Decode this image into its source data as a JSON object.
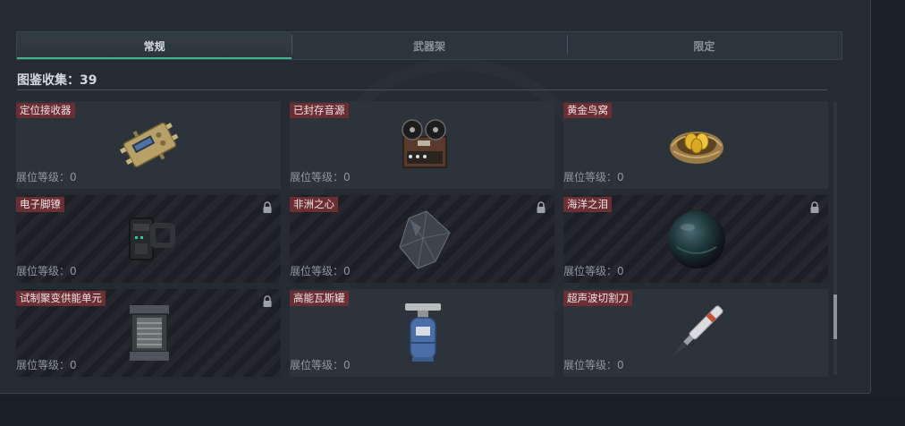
{
  "tabs": [
    {
      "label": "常规",
      "active": true
    },
    {
      "label": "武器架",
      "active": false
    },
    {
      "label": "限定",
      "active": false
    }
  ],
  "collection": {
    "label": "图鉴收集：",
    "count": "39"
  },
  "items": [
    {
      "name": "定位接收器",
      "level": "展位等级：0",
      "locked": false,
      "icon": "gps-receiver-icon"
    },
    {
      "name": "已封存音源",
      "level": "展位等级：0",
      "locked": false,
      "icon": "reel-tape-recorder-icon"
    },
    {
      "name": "黄金鸟窝",
      "level": "展位等级：0",
      "locked": false,
      "icon": "golden-nest-icon"
    },
    {
      "name": "电子脚镣",
      "level": "展位等级：0",
      "locked": true,
      "icon": "ankle-monitor-icon"
    },
    {
      "name": "非洲之心",
      "level": "展位等级：0",
      "locked": true,
      "icon": "diamond-icon"
    },
    {
      "name": "海洋之泪",
      "level": "展位等级：0",
      "locked": true,
      "icon": "ocean-pearl-icon"
    },
    {
      "name": "试制聚变供能单元",
      "level": "展位等级：0",
      "locked": true,
      "icon": "fusion-cell-icon"
    },
    {
      "name": "高能瓦斯罐",
      "level": "展位等级：0",
      "locked": false,
      "icon": "gas-canister-icon"
    },
    {
      "name": "超声波切割刀",
      "level": "展位等级：0",
      "locked": false,
      "icon": "ultrasonic-cutter-icon"
    }
  ],
  "colors": {
    "accent": "#3fb78a",
    "name_tag": "#6b2f33",
    "panel": "#242b33"
  }
}
